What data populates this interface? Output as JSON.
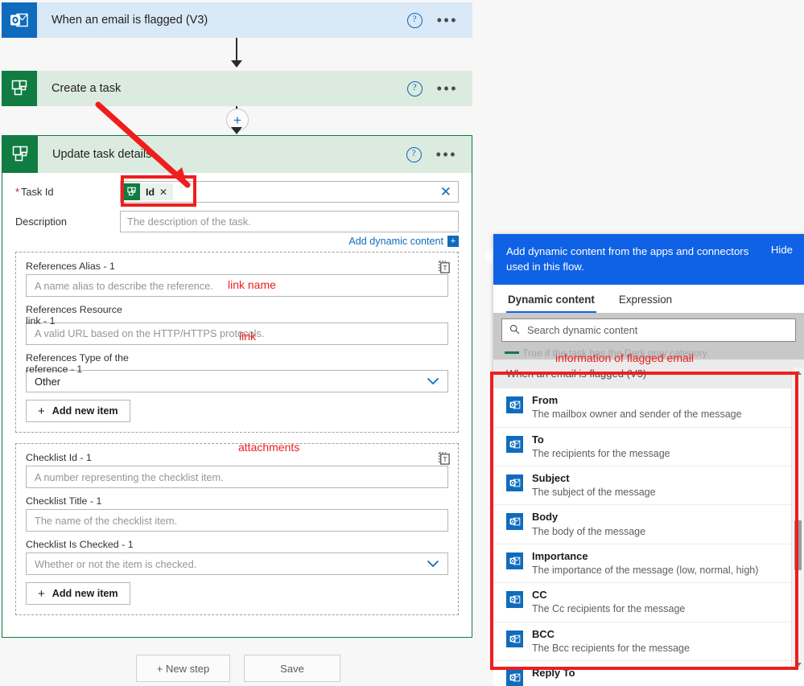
{
  "flow": {
    "trigger": {
      "title": "When an email is flagged (V3)",
      "icon": "outlook-icon",
      "help_label": "?",
      "more_label": "•••"
    },
    "action": {
      "title": "Create a task",
      "icon": "planner-icon",
      "help_label": "?",
      "more_label": "•••"
    },
    "update": {
      "title": "Update task details",
      "icon": "planner-icon",
      "help_label": "?",
      "more_label": "•••"
    },
    "insert_step_label": "+"
  },
  "form": {
    "task_id": {
      "label": "Task Id",
      "required_marker": "*",
      "token_text": "Id",
      "token_remove": "✕",
      "clear_label": "✕"
    },
    "description": {
      "label": "Description",
      "placeholder": "The description of the task."
    },
    "add_dynamic_content": {
      "label": "Add dynamic content",
      "plus": "+"
    },
    "references_group": {
      "copy_icon": "duplicate-icon",
      "fields": [
        {
          "label": "References Alias - 1",
          "sub_label": "",
          "placeholder": "A name alias to describe the reference.",
          "type": "text"
        },
        {
          "label": "References Resource",
          "sub_label": "link - 1",
          "placeholder": "A valid URL based on the HTTP/HTTPS protocols.",
          "type": "text"
        },
        {
          "label": "References Type of the",
          "sub_label": "reference - 1",
          "value": "Other",
          "type": "select",
          "chevron": "⌄"
        }
      ],
      "add_new_item": "Add new item",
      "add_plus": "+"
    },
    "checklist_group": {
      "copy_icon": "duplicate-icon",
      "fields": [
        {
          "label": "Checklist Id - 1",
          "sub_label": "",
          "placeholder": "A number representing the checklist item.",
          "type": "text"
        },
        {
          "label": "Checklist Title - 1",
          "sub_label": "",
          "placeholder": "The name of the checklist item.",
          "type": "text"
        },
        {
          "label": "Checklist Is Checked - 1",
          "sub_label": "",
          "placeholder": "Whether or not the item is checked.",
          "type": "select",
          "chevron": "⌄"
        }
      ],
      "add_new_item": "Add new item",
      "add_plus": "+"
    }
  },
  "footer": {
    "new_step": "+ New step",
    "save": "Save"
  },
  "dynamic_panel": {
    "banner_text": "Add dynamic content from the apps and connectors used in this flow.",
    "hide_label": "Hide",
    "tabs": [
      {
        "label": "Dynamic content",
        "active": true
      },
      {
        "label": "Expression",
        "active": false
      }
    ],
    "search_placeholder": "Search dynamic content",
    "search_icon": "search-icon",
    "partially_hidden_row": "True if the task has the Dark gray category.",
    "group_header": "When an email is flagged (V3)",
    "items": [
      {
        "name": "From",
        "desc": "The mailbox owner and sender of the message",
        "icon": "outlook-icon"
      },
      {
        "name": "To",
        "desc": "The recipients for the message",
        "icon": "outlook-icon"
      },
      {
        "name": "Subject",
        "desc": "The subject of the message",
        "icon": "outlook-icon"
      },
      {
        "name": "Body",
        "desc": "The body of the message",
        "icon": "outlook-icon"
      },
      {
        "name": "Importance",
        "desc": "The importance of the message (low, normal, high)",
        "icon": "outlook-icon"
      },
      {
        "name": "CC",
        "desc": "The Cc recipients for the message",
        "icon": "outlook-icon"
      },
      {
        "name": "BCC",
        "desc": "The Bcc recipients for the message",
        "icon": "outlook-icon"
      },
      {
        "name": "Reply To",
        "desc": "",
        "icon": "outlook-icon"
      }
    ]
  },
  "annotations": {
    "link_name": "link name",
    "link": "link",
    "attachments": "attachments",
    "information_of_flagged_email": "information of flagged email",
    "accent_color": "#f01d1d"
  }
}
